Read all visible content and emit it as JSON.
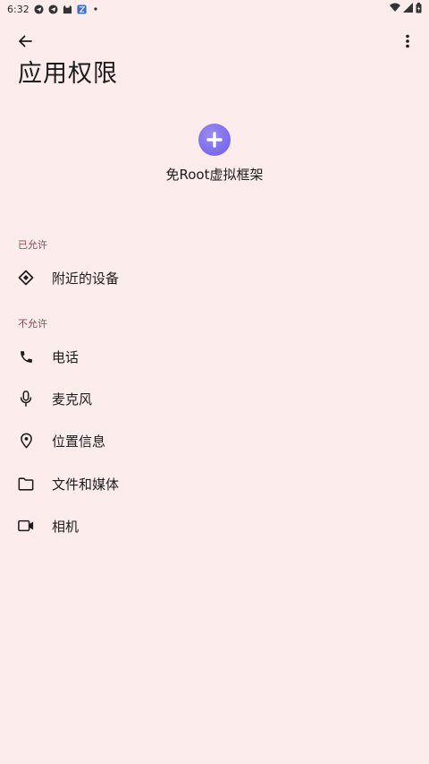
{
  "status_bar": {
    "time": "6:32",
    "notification_icons": [
      "telegram-icon",
      "telegram-icon",
      "cat-icon",
      "app-icon",
      "dot-icon"
    ],
    "system_icons": [
      "wifi-icon",
      "signal-icon",
      "battery-icon"
    ]
  },
  "app_bar": {
    "title": "应用权限"
  },
  "app": {
    "name": "免Root虚拟框架",
    "icon_color": "#7b6cf0"
  },
  "sections": {
    "allowed": {
      "header": "已允许",
      "items": [
        {
          "label": "附近的设备",
          "icon": "nearby-devices-icon"
        }
      ]
    },
    "denied": {
      "header": "不允许",
      "items": [
        {
          "label": "电话",
          "icon": "phone-icon"
        },
        {
          "label": "麦克风",
          "icon": "microphone-icon"
        },
        {
          "label": "位置信息",
          "icon": "location-icon"
        },
        {
          "label": "文件和媒体",
          "icon": "folder-icon"
        },
        {
          "label": "相机",
          "icon": "camera-icon"
        }
      ]
    }
  },
  "colors": {
    "background": "#fcecec",
    "section_header": "#8d4a4e",
    "text": "#1f1b1b"
  }
}
